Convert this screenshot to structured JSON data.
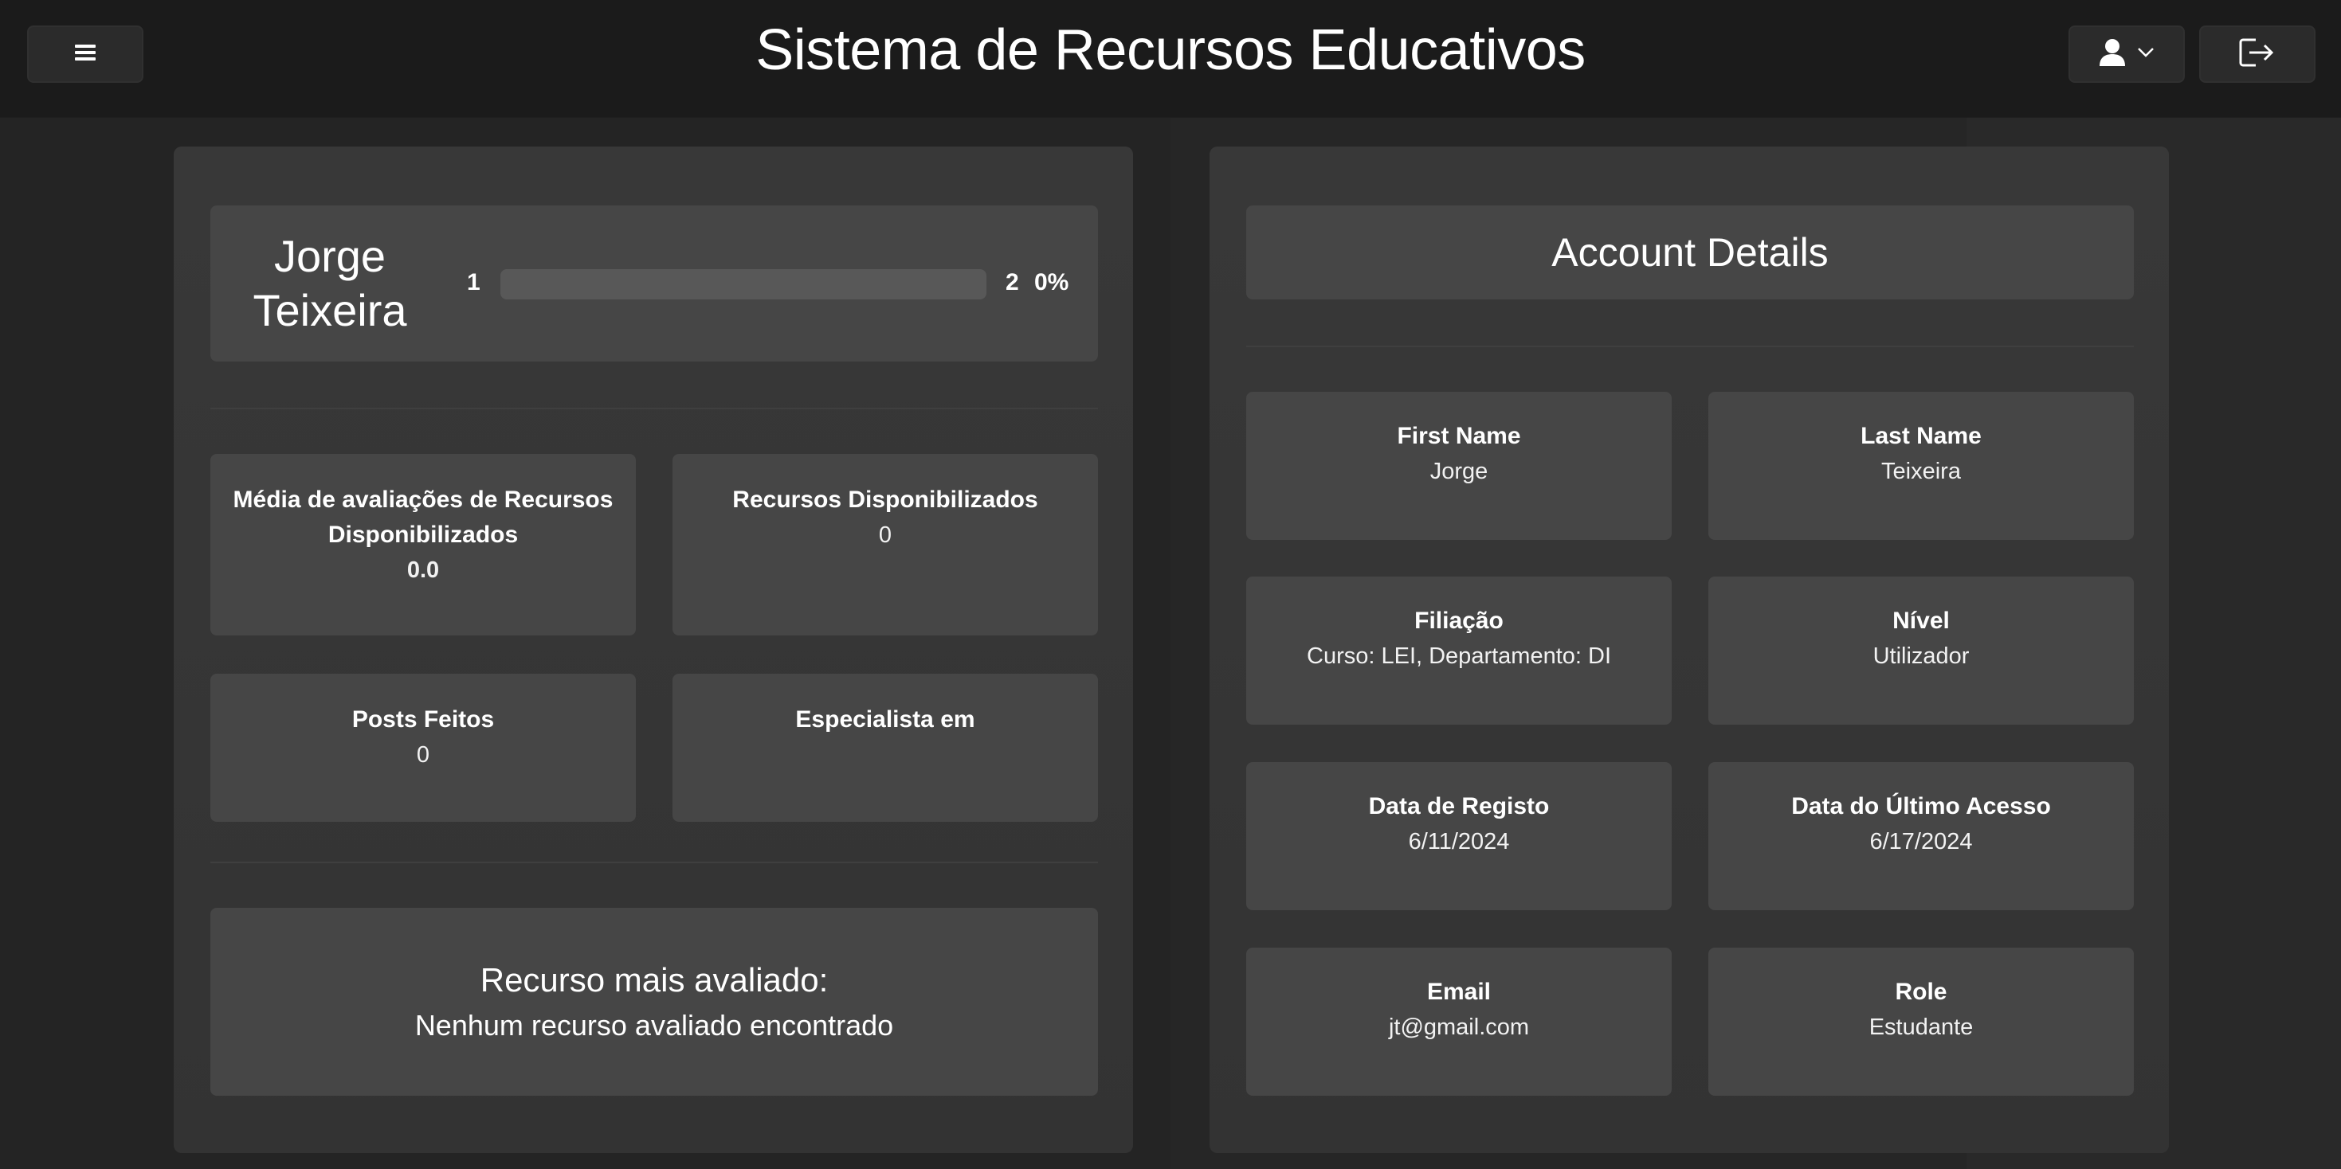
{
  "header": {
    "title": "Sistema de Recursos Educativos",
    "menu_icon": "hamburger-menu-icon",
    "user_icon": "user-icon",
    "chevron_icon": "chevron-down-icon",
    "logout_icon": "logout-icon"
  },
  "profile": {
    "name": "Jorge Teixeira",
    "level_current": "1",
    "level_next": "2",
    "progress_text": "0%",
    "progress_fraction": 0.0
  },
  "stats": [
    {
      "title": "Média de avaliações de Recursos Disponibilizados",
      "value": "0.0"
    },
    {
      "title": "Recursos Disponibilizados",
      "value": "0"
    },
    {
      "title": "Posts Feitos",
      "value": "0"
    },
    {
      "title": "Especialista em",
      "value": ""
    }
  ],
  "best_resource": {
    "title": "Recurso mais avaliado:",
    "value": "Nenhum recurso avaliado encontrado"
  },
  "account": {
    "title": "Account Details",
    "fields": [
      {
        "label": "First Name",
        "value": "Jorge"
      },
      {
        "label": "Last Name",
        "value": "Teixeira"
      },
      {
        "label": "Filiação",
        "value": "Curso: LEI, Departamento: DI"
      },
      {
        "label": "Nível",
        "value": "Utilizador"
      },
      {
        "label": "Data de Registo",
        "value": "6/11/2024"
      },
      {
        "label": "Data do Último Acesso",
        "value": "6/17/2024"
      },
      {
        "label": "Email",
        "value": "jt@gmail.com"
      },
      {
        "label": "Role",
        "value": "Estudante"
      }
    ]
  }
}
